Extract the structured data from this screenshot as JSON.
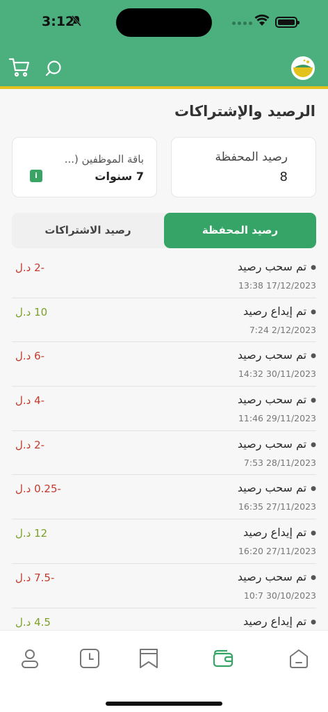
{
  "status_bar": {
    "time": "3:12"
  },
  "header": {
    "icons": [
      "cart-icon",
      "search-icon",
      "app-logo"
    ],
    "colors": {
      "primary": "#4caf7e",
      "accent": "#e3c21d"
    }
  },
  "page": {
    "title": "الرصيد والإشتراكات"
  },
  "cards": {
    "wallet": {
      "title": "رصيد المحفظة",
      "value": "8"
    },
    "package": {
      "title": "باقة الموظفين (...",
      "value": "7 سنوات",
      "badge": "i"
    }
  },
  "tabs": [
    {
      "label": "رصيد المحفظة",
      "active": true
    },
    {
      "label": "رصيد الاشتراكات",
      "active": false
    }
  ],
  "transactions": [
    {
      "title": "تم سحب رصيد",
      "date": "13:38 17/12/2023",
      "amount": "-2 د.ل",
      "type": "withdraw"
    },
    {
      "title": "تم إيداع رصيد",
      "date": "7:24 2/12/2023",
      "amount": "10 د.ل",
      "type": "deposit"
    },
    {
      "title": "تم سحب رصيد",
      "date": "14:32 30/11/2023",
      "amount": "-6 د.ل",
      "type": "withdraw"
    },
    {
      "title": "تم سحب رصيد",
      "date": "11:46 29/11/2023",
      "amount": "-4 د.ل",
      "type": "withdraw"
    },
    {
      "title": "تم سحب رصيد",
      "date": "7:53 28/11/2023",
      "amount": "-2 د.ل",
      "type": "withdraw"
    },
    {
      "title": "تم سحب رصيد",
      "date": "16:35 27/11/2023",
      "amount": "-0.25 د.ل",
      "type": "withdraw"
    },
    {
      "title": "تم إيداع رصيد",
      "date": "16:20 27/11/2023",
      "amount": "12 د.ل",
      "type": "deposit"
    },
    {
      "title": "تم سحب رصيد",
      "date": "10:7 30/10/2023",
      "amount": "-7.5 د.ل",
      "type": "withdraw"
    },
    {
      "title": "تم إيداع رصيد",
      "date": "",
      "amount": "4.5 د.ل",
      "type": "deposit"
    }
  ],
  "bottom_nav": {
    "items": [
      "profile-icon",
      "history-icon",
      "bookmark-icon",
      "wallet-icon",
      "home-icon"
    ],
    "active": "wallet-icon"
  }
}
